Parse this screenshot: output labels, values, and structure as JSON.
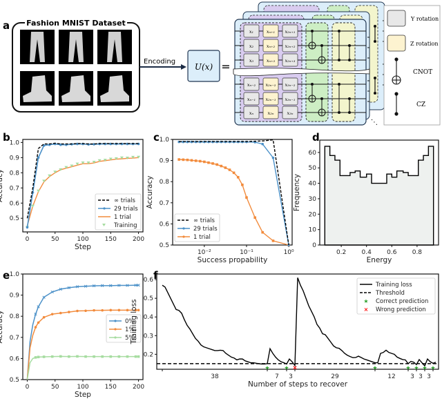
{
  "panel_a": {
    "letter": "a",
    "dataset_title": "Fashion MNIST Dataset",
    "images": [
      "trousers",
      "trousers",
      "trousers",
      "ankle-boot",
      "ankle-boot",
      "ankle-boot"
    ],
    "arrow_label": "Encoding",
    "unitary_label": "U(x)",
    "equals": "=",
    "circuit": {
      "rows_top": [
        [
          "x₁",
          "xₙ₊₁",
          "x₂ₙ₊₁"
        ],
        [
          "x₂",
          "xₙ₊₂",
          "x₂ₙ₊₂"
        ],
        [
          "x₃",
          "xₙ₊₃",
          "x₂ₙ₊₃"
        ]
      ],
      "rows_bottom": [
        [
          "xₙ₋₂",
          "x₂ₙ₋₂",
          "x₃ₙ₋₂"
        ],
        [
          "xₙ₋₁",
          "x₂ₙ₋₁",
          "x₃ₙ₋₁"
        ],
        [
          "xₙ",
          "x₂ₙ",
          "x₃ₙ"
        ]
      ],
      "ellipsis": "⋱"
    },
    "legend": [
      {
        "label": "Y rotation",
        "kind": "y-rotation",
        "color": "#e8e8e8"
      },
      {
        "label": "Z rotation",
        "kind": "z-rotation",
        "color": "#fdf3d0"
      },
      {
        "label": "CNOT",
        "kind": "cnot"
      },
      {
        "label": "CZ",
        "kind": "cz"
      }
    ],
    "colors": {
      "layer_bg": "#dceefa",
      "encoding_block": "#d9ccf0",
      "cnot_block": "#cdeec4",
      "cz_block": "#f3f5cd",
      "y_gate": "#e8e8e8",
      "z_gate": "#fdf3d0"
    }
  },
  "chart_data": [
    {
      "id": "b",
      "type": "line",
      "xlabel": "Step",
      "ylabel": "Accuracy",
      "xlim": [
        -8,
        208
      ],
      "ylim": [
        0.41,
        1.02
      ],
      "xticks": [
        0,
        50,
        100,
        150,
        200
      ],
      "yticks": [
        0.5,
        0.6,
        0.7,
        0.8,
        0.9,
        1.0
      ],
      "ytick_labels": [
        "0.5",
        "0.6",
        "0.7",
        "0.8",
        "0.9",
        "1.0"
      ],
      "legend_position": "lower-right",
      "series": [
        {
          "name": "∞ trials",
          "style": "dashed",
          "color": "#000000",
          "x": [
            0,
            10,
            20,
            30,
            40,
            50,
            60,
            70,
            80,
            90,
            100,
            110,
            120,
            130,
            140,
            150,
            160,
            170,
            180,
            190,
            200
          ],
          "y": [
            0.5,
            0.7,
            0.96,
            0.99,
            0.99,
            0.995,
            0.99,
            0.99,
            0.99,
            0.993,
            0.993,
            0.99,
            0.99,
            0.993,
            0.993,
            0.993,
            0.993,
            0.993,
            0.993,
            0.993,
            0.993
          ]
        },
        {
          "name": "29 trials",
          "style": "solid-marker",
          "color": "#4a90c8",
          "x": [
            0,
            10,
            20,
            30,
            40,
            50,
            60,
            70,
            80,
            90,
            100,
            110,
            120,
            130,
            140,
            150,
            160,
            170,
            180,
            190,
            200
          ],
          "y": [
            0.44,
            0.67,
            0.9,
            0.98,
            0.985,
            0.99,
            0.985,
            0.985,
            0.988,
            0.99,
            0.99,
            0.987,
            0.988,
            0.99,
            0.99,
            0.99,
            0.99,
            0.99,
            0.99,
            0.99,
            0.99
          ]
        },
        {
          "name": "1 trial",
          "style": "solid",
          "color": "#f28b3c",
          "x": [
            0,
            10,
            20,
            30,
            40,
            50,
            60,
            70,
            80,
            90,
            100,
            110,
            120,
            130,
            140,
            150,
            160,
            170,
            180,
            190,
            200
          ],
          "y": [
            0.45,
            0.58,
            0.675,
            0.74,
            0.775,
            0.8,
            0.82,
            0.83,
            0.84,
            0.85,
            0.86,
            0.86,
            0.865,
            0.875,
            0.88,
            0.885,
            0.89,
            0.892,
            0.895,
            0.897,
            0.9
          ]
        },
        {
          "name": "Training",
          "style": "marker-triangle",
          "color": "#a6dca0",
          "x": [
            0,
            10,
            20,
            30,
            40,
            50,
            60,
            70,
            80,
            90,
            100,
            110,
            120,
            130,
            140,
            150,
            160,
            170,
            180,
            190,
            200
          ],
          "y": [
            0.44,
            0.58,
            0.68,
            0.745,
            0.78,
            0.805,
            0.82,
            0.835,
            0.845,
            0.858,
            0.865,
            0.865,
            0.87,
            0.88,
            0.883,
            0.89,
            0.893,
            0.898,
            0.897,
            0.902,
            0.903
          ]
        }
      ]
    },
    {
      "id": "c",
      "type": "line",
      "xlabel": "Success propability",
      "ylabel": "Accuracy",
      "xscale": "log",
      "xlim_log10": [
        -2.75,
        0.08
      ],
      "ylim": [
        0.5,
        1.0
      ],
      "xticks_log10": [
        -2,
        -1,
        0
      ],
      "xtick_labels": [
        "10⁻²",
        "10⁻¹",
        "10⁰"
      ],
      "yticks": [
        0.5,
        0.6,
        0.7,
        0.8,
        0.9,
        1.0
      ],
      "ytick_labels": [
        "0.5",
        "0.6",
        "0.7",
        "0.8",
        "0.9",
        "1.0"
      ],
      "legend_position": "lower-left",
      "series": [
        {
          "name": "∞ trials",
          "style": "dashed",
          "color": "#000000",
          "x_log10": [
            -2.6,
            -1.0,
            -0.6,
            -0.37,
            0.0
          ],
          "y": [
            0.99,
            0.99,
            0.993,
            0.998,
            0.5
          ]
        },
        {
          "name": "29 trials",
          "style": "solid-marker",
          "color": "#4a90c8",
          "x_log10": [
            -2.6,
            -2.5,
            -2.4,
            -2.3,
            -2.2,
            -2.1,
            -2.0,
            -1.9,
            -1.8,
            -1.7,
            -1.6,
            -1.5,
            -1.4,
            -1.3,
            -1.2,
            -1.1,
            -1.0,
            -0.8,
            -0.62,
            -0.37,
            0.0
          ],
          "y": [
            0.988,
            0.988,
            0.988,
            0.988,
            0.988,
            0.988,
            0.988,
            0.988,
            0.988,
            0.988,
            0.988,
            0.988,
            0.988,
            0.988,
            0.988,
            0.988,
            0.988,
            0.987,
            0.978,
            0.913,
            0.5
          ]
        },
        {
          "name": "1 trial",
          "style": "solid-marker-square",
          "color": "#f28b3c",
          "x_log10": [
            -2.6,
            -2.5,
            -2.4,
            -2.3,
            -2.2,
            -2.1,
            -2.0,
            -1.9,
            -1.8,
            -1.7,
            -1.6,
            -1.5,
            -1.4,
            -1.3,
            -1.2,
            -1.1,
            -1.0,
            -0.8,
            -0.62,
            -0.37,
            0.0
          ],
          "y": [
            0.905,
            0.904,
            0.903,
            0.901,
            0.899,
            0.897,
            0.894,
            0.89,
            0.886,
            0.881,
            0.874,
            0.866,
            0.856,
            0.842,
            0.821,
            0.785,
            0.725,
            0.63,
            0.56,
            0.52,
            0.5
          ]
        }
      ]
    },
    {
      "id": "d",
      "type": "bar",
      "histogram": true,
      "xlabel": "Energy",
      "ylabel": "Frequency",
      "xlim": [
        0.03,
        0.97
      ],
      "ylim": [
        0,
        68
      ],
      "xticks": [
        0.2,
        0.4,
        0.6,
        0.8
      ],
      "xtick_labels": [
        "0.2",
        "0.4",
        "0.6",
        "0.8"
      ],
      "yticks": [
        0,
        10,
        20,
        30,
        40,
        50,
        60
      ],
      "bin_edges": [
        0.07,
        0.11,
        0.15,
        0.19,
        0.27,
        0.31,
        0.35,
        0.4,
        0.44,
        0.56,
        0.6,
        0.64,
        0.69,
        0.73,
        0.81,
        0.85,
        0.89,
        0.93
      ],
      "values": [
        64,
        58,
        55,
        45,
        47,
        48,
        44,
        46,
        40,
        46,
        44,
        48,
        47,
        45,
        55,
        58,
        64
      ],
      "fill_color": "#eef1ef",
      "edge_color": "#000000"
    },
    {
      "id": "e",
      "type": "line",
      "xlabel": "Step",
      "ylabel": "Accuracy",
      "xlim": [
        -8,
        208
      ],
      "ylim": [
        0.5,
        1.0
      ],
      "xticks": [
        0,
        50,
        100,
        150,
        200
      ],
      "yticks": [
        0.5,
        0.6,
        0.7,
        0.8,
        0.9,
        1.0
      ],
      "ytick_labels": [
        "0.5",
        "0.6",
        "0.7",
        "0.8",
        "0.9",
        "1.0"
      ],
      "legend_position": "center-right",
      "series": [
        {
          "name": "0‰",
          "color": "#4a90c8",
          "x": [
            0,
            5,
            10,
            15,
            20,
            30,
            45,
            60,
            75,
            90,
            105,
            120,
            135,
            150,
            165,
            180,
            195,
            200
          ],
          "y": [
            0.5,
            0.68,
            0.76,
            0.81,
            0.845,
            0.89,
            0.915,
            0.928,
            0.935,
            0.94,
            0.942,
            0.944,
            0.945,
            0.945,
            0.946,
            0.946,
            0.947,
            0.947
          ]
        },
        {
          "name": "1‰",
          "color": "#f28b3c",
          "x": [
            0,
            5,
            10,
            15,
            20,
            30,
            45,
            60,
            75,
            90,
            105,
            120,
            135,
            150,
            165,
            180,
            195,
            200
          ],
          "y": [
            0.5,
            0.65,
            0.71,
            0.748,
            0.77,
            0.795,
            0.81,
            0.815,
            0.82,
            0.825,
            0.826,
            0.828,
            0.828,
            0.829,
            0.829,
            0.829,
            0.829,
            0.829
          ]
        },
        {
          "name": "5‰",
          "color": "#a6dca0",
          "x": [
            0,
            5,
            10,
            15,
            20,
            30,
            45,
            60,
            75,
            90,
            105,
            120,
            135,
            150,
            165,
            180,
            195,
            200
          ],
          "y": [
            0.5,
            0.58,
            0.6,
            0.605,
            0.607,
            0.608,
            0.609,
            0.61,
            0.609,
            0.61,
            0.609,
            0.609,
            0.609,
            0.609,
            0.609,
            0.609,
            0.609,
            0.609
          ]
        }
      ]
    },
    {
      "id": "f",
      "type": "line",
      "xlabel": "Number of steps to recover",
      "ylabel": "Training loss",
      "xlim": [
        -2,
        100
      ],
      "ylim": [
        0.12,
        0.63
      ],
      "yticks": [
        0.2,
        0.3,
        0.4,
        0.5,
        0.6
      ],
      "ytick_labels": [
        "0.2",
        "0.3",
        "0.4",
        "0.5",
        "0.6"
      ],
      "xtick_positions": [
        0,
        38,
        45,
        48,
        77,
        89,
        92,
        95,
        98
      ],
      "segment_labels": [
        {
          "label": "38",
          "center": 19
        },
        {
          "label": "7",
          "center": 41.5
        },
        {
          "label": "3",
          "center": 46.5
        },
        {
          "label": "29",
          "center": 62.5
        },
        {
          "label": "12",
          "center": 83
        },
        {
          "label": "3",
          "center": 90.5
        },
        {
          "label": "3",
          "center": 93.5
        },
        {
          "label": "3",
          "center": 96.5
        }
      ],
      "threshold": 0.15,
      "legend_position": "upper-right",
      "series": [
        {
          "name": "Training loss",
          "style": "solid",
          "color": "#000000",
          "x": [
            0,
            1,
            2,
            3,
            4,
            5,
            6,
            7,
            8,
            9,
            10,
            11,
            12,
            13,
            14,
            15,
            16,
            17,
            18,
            19,
            20,
            21,
            22,
            23,
            24,
            25,
            26,
            27,
            28,
            29,
            30,
            31,
            32,
            33,
            34,
            35,
            36,
            37,
            38,
            39,
            40,
            41,
            42,
            43,
            44,
            45,
            46,
            47,
            48,
            49,
            50,
            51,
            52,
            53,
            54,
            55,
            56,
            57,
            58,
            59,
            60,
            61,
            62,
            63,
            64,
            65,
            66,
            67,
            68,
            69,
            70,
            71,
            72,
            73,
            74,
            75,
            76,
            77,
            78,
            79,
            80,
            81,
            82,
            83,
            84,
            85,
            86,
            87,
            88,
            89,
            90,
            91,
            92,
            93,
            94,
            95,
            96,
            97,
            98,
            99
          ],
          "y": [
            0.57,
            0.56,
            0.53,
            0.5,
            0.47,
            0.44,
            0.435,
            0.42,
            0.385,
            0.355,
            0.335,
            0.31,
            0.285,
            0.27,
            0.25,
            0.24,
            0.235,
            0.23,
            0.225,
            0.22,
            0.22,
            0.222,
            0.22,
            0.205,
            0.195,
            0.185,
            0.18,
            0.17,
            0.175,
            0.175,
            0.165,
            0.16,
            0.155,
            0.155,
            0.152,
            0.15,
            0.148,
            0.148,
            0.15,
            0.23,
            0.205,
            0.185,
            0.17,
            0.16,
            0.155,
            0.148,
            0.175,
            0.16,
            0.14,
            0.61,
            0.57,
            0.54,
            0.5,
            0.46,
            0.43,
            0.4,
            0.36,
            0.34,
            0.31,
            0.305,
            0.285,
            0.265,
            0.245,
            0.235,
            0.232,
            0.22,
            0.205,
            0.195,
            0.188,
            0.182,
            0.183,
            0.19,
            0.183,
            0.175,
            0.17,
            0.165,
            0.16,
            0.155,
            0.155,
            0.205,
            0.21,
            0.222,
            0.21,
            0.205,
            0.2,
            0.185,
            0.178,
            0.172,
            0.17,
            0.15,
            0.162,
            0.158,
            0.145,
            0.172,
            0.155,
            0.138,
            0.175,
            0.16,
            0.152,
            0.158
          ]
        },
        {
          "name": "Threshold",
          "style": "dashed",
          "color": "#000000"
        },
        {
          "name": "Correct prediction",
          "style": "marker-star",
          "color": "#2ca02c",
          "x": [
            38,
            45,
            77,
            89,
            92,
            95,
            98
          ]
        },
        {
          "name": "Wrong prediction",
          "style": "marker-x",
          "color": "#ff0000",
          "x": [
            48
          ]
        }
      ]
    }
  ],
  "panel_letters": [
    "a",
    "b",
    "c",
    "d",
    "e",
    "f"
  ]
}
